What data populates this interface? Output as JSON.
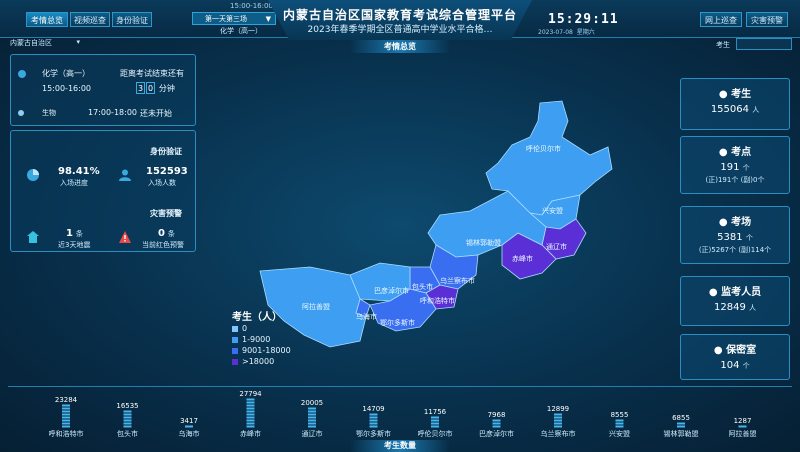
{
  "header": {
    "title": "内蒙古自治区国家教育考试综合管理平台",
    "subtitle": "2023年春季学期全区普通高中学业水平合格…",
    "top_time": "15:00-16:00",
    "tabs": [
      "考情总览",
      "视频巡查",
      "身份验证"
    ],
    "session": "第一天第三场",
    "subject": "化学（高一）",
    "clock": "15:29:11",
    "date": "2023-07-08",
    "weekday": "星期六",
    "right_tabs": [
      "网上巡查",
      "灾害预警"
    ]
  },
  "filters": {
    "region": "内蒙古自治区",
    "section_title": "考情总览",
    "search_label": "考生"
  },
  "exam_panel": {
    "subject": "化学（高一）",
    "time": "15:00-16:00",
    "countdown_label": "距离考试结束还有",
    "countdown_digits": [
      "3",
      "0"
    ],
    "countdown_unit": "分钟",
    "next_subject": "生物",
    "next_time": "17:00-18:00",
    "next_status": "还未开始"
  },
  "identity_panel": {
    "title": "身份验证",
    "entry_rate": "98.41%",
    "entry_rate_label": "入场进度",
    "entry_count": "152593",
    "entry_count_label": "入场人数",
    "warn_title": "灾害预警",
    "recent_count": "1",
    "recent_unit": "条",
    "recent_label": "近3天地震",
    "red_count": "0",
    "red_unit": "条",
    "red_label": "当前红色预警"
  },
  "cards": [
    {
      "title": "考生",
      "value": "155064",
      "unit": "人",
      "sub": ""
    },
    {
      "title": "考点",
      "value": "191",
      "unit": "个",
      "sub": "(正)191个     (副)0个"
    },
    {
      "title": "考场",
      "value": "5381",
      "unit": "个",
      "sub": "(正)5267个     (副)114个"
    },
    {
      "title": "监考人员",
      "value": "12849",
      "unit": "人",
      "sub": ""
    },
    {
      "title": "保密室",
      "value": "104",
      "unit": "个",
      "sub": ""
    }
  ],
  "map": {
    "regions": [
      "呼伦贝尔市",
      "兴安盟",
      "锡林郭勒盟",
      "通辽市",
      "赤峰市",
      "乌兰察布市",
      "包头市",
      "呼和浩特市",
      "巴彦淖尔市",
      "鄂尔多斯市",
      "乌海市",
      "阿拉善盟"
    ],
    "legend_title": "考生（人）",
    "legend": [
      {
        "label": "0",
        "color": "#7ec7ff"
      },
      {
        "label": "1-9000",
        "color": "#3e9ef2"
      },
      {
        "label": "9001-18000",
        "color": "#3a6ef0"
      },
      {
        "label": ">18000",
        "color": "#5b2fd6"
      }
    ],
    "colors": {
      "low": "#3e9ef2",
      "mid": "#3a6ef0",
      "high": "#5b2fd6"
    }
  },
  "bottom": {
    "title": "考生数量"
  },
  "chart_data": {
    "type": "bar",
    "categories": [
      "呼和浩特市",
      "包头市",
      "乌海市",
      "赤峰市",
      "通辽市",
      "鄂尔多斯市",
      "呼伦贝尔市",
      "巴彦淖尔市",
      "乌兰察布市",
      "兴安盟",
      "锡林郭勒盟",
      "阿拉善盟"
    ],
    "values": [
      23284,
      16535,
      3417,
      27794,
      20005,
      14709,
      11756,
      7968,
      12899,
      8555,
      6855,
      1287
    ],
    "title": "考生数量",
    "ylim": [
      0,
      28000
    ]
  }
}
